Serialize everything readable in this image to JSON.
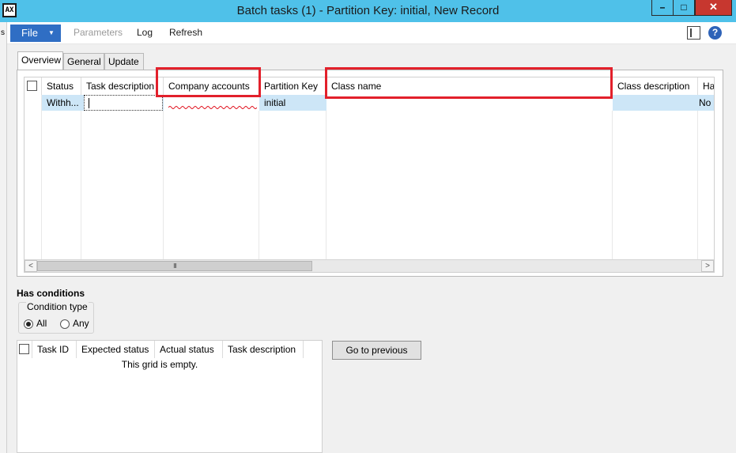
{
  "window": {
    "title": "Batch tasks (1) - Partition Key: initial, New Record",
    "app_icon_text": "AX",
    "minimize": "–",
    "maximize": "□",
    "close": "✕"
  },
  "background_window": {
    "fragment": "s"
  },
  "action_pane": {
    "file_label": "File",
    "file_arrow": "▼",
    "items": [
      "Parameters",
      "Log",
      "Refresh"
    ],
    "help_label": "?"
  },
  "tabs": [
    "Overview",
    "General",
    "Update"
  ],
  "grid": {
    "columns": [
      "Status",
      "Task description",
      "Company accounts",
      "Partition Key",
      "Class name",
      "Class description",
      "Ha"
    ],
    "rows": [
      {
        "status": "Withh...",
        "task_description": "",
        "company_accounts": "",
        "partition_key": "initial",
        "class_name": "",
        "class_description": "",
        "ha": "No"
      }
    ],
    "scroll_left": "<",
    "scroll_right": ">",
    "scroll_thumb": "III"
  },
  "conditions": {
    "section_title": "Has conditions",
    "condition_type_label": "Condition type",
    "options": [
      "All",
      "Any"
    ],
    "selected": "All",
    "grid_columns": [
      "Task ID",
      "Expected status",
      "Actual status",
      "Task description"
    ],
    "empty_text": "This grid is empty.",
    "go_to_previous": "Go to previous"
  },
  "colors": {
    "titlebar": "#4fc1e9",
    "file_button": "#2f6ec4",
    "selected_row": "#cde6f7",
    "highlight": "#e2202b"
  }
}
